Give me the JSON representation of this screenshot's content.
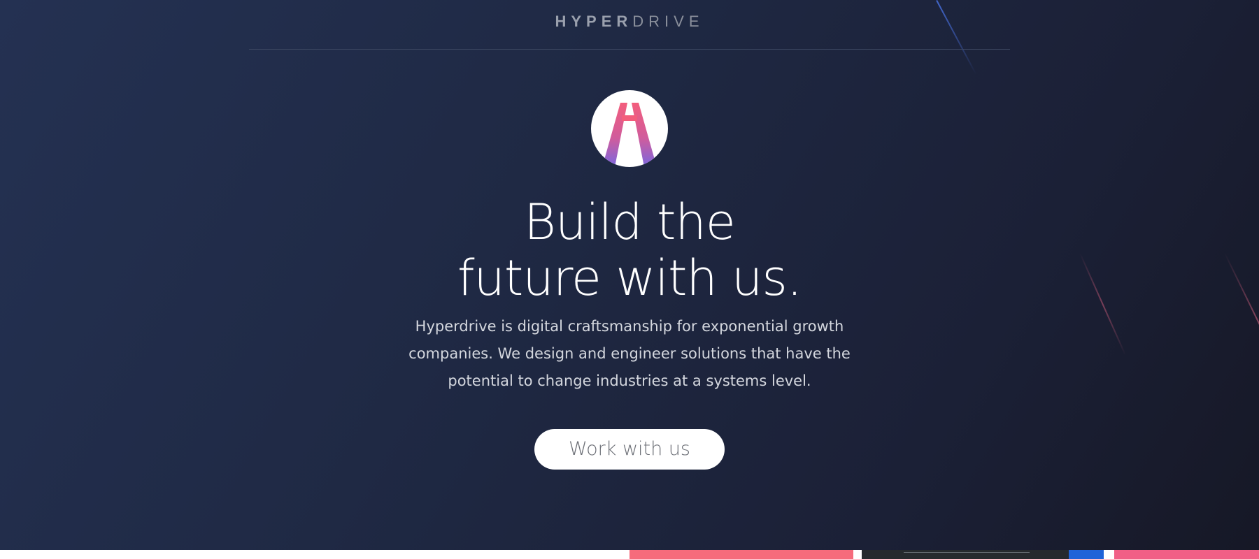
{
  "header": {
    "brand_bold": "HYPER",
    "brand_light": "DRIVE"
  },
  "logo": {
    "icon": "hyperdrive-h-logo-icon",
    "gradient": [
      "#f35d7c",
      "#7a67e0"
    ]
  },
  "hero": {
    "headline_line1": "Build the",
    "headline_line2": "future with us.",
    "description_line1": "Hyperdrive is digital craftsmanship for exponential growth",
    "description_line2": "companies. We design and engineer solutions that have the",
    "description_line3": "potential to change industries at a systems level.",
    "cta_label": "Work with us"
  },
  "colors": {
    "background": "#1f2944",
    "accent_pink": "#f35d7c",
    "accent_purple": "#7a67e0",
    "button_bg": "#ffffff"
  },
  "preview_strip": {
    "tiles": [
      "#f66b7c",
      "#252a2e",
      "#1f63d8",
      "#f15f86"
    ]
  }
}
